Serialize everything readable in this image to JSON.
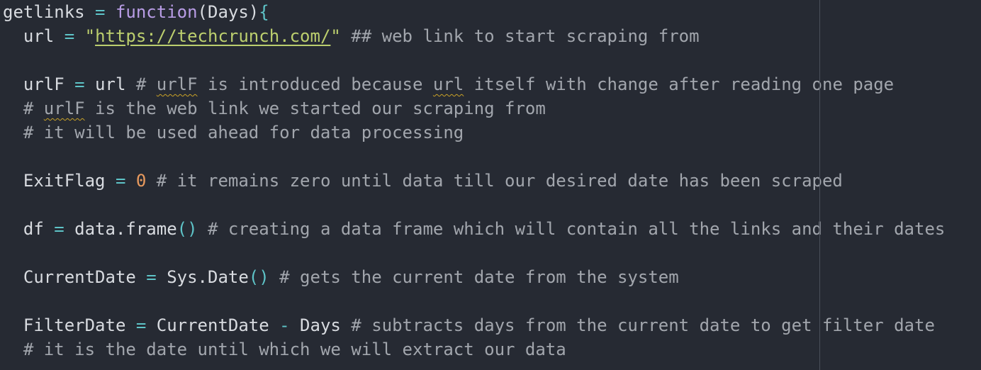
{
  "editor": {
    "lines": [
      [
        {
          "t": "getlinks",
          "c": "default"
        },
        {
          "t": " ",
          "c": "default"
        },
        {
          "t": "=",
          "c": "op"
        },
        {
          "t": " ",
          "c": "default"
        },
        {
          "t": "function",
          "c": "kw"
        },
        {
          "t": "(",
          "c": "default"
        },
        {
          "t": "Days",
          "c": "default"
        },
        {
          "t": ")",
          "c": "default"
        },
        {
          "t": "{",
          "c": "paren"
        }
      ],
      [
        {
          "t": "  url ",
          "c": "default"
        },
        {
          "t": "=",
          "c": "op"
        },
        {
          "t": " ",
          "c": "default"
        },
        {
          "t": "\"",
          "c": "str"
        },
        {
          "t": "https://techcrunch.com/",
          "c": "url"
        },
        {
          "t": "\"",
          "c": "str"
        },
        {
          "t": " ## web link to start scraping from",
          "c": "comment"
        }
      ],
      [],
      [
        {
          "t": "  urlF ",
          "c": "default"
        },
        {
          "t": "=",
          "c": "op"
        },
        {
          "t": " url ",
          "c": "default"
        },
        {
          "t": "# ",
          "c": "comment"
        },
        {
          "t": "urlF",
          "c": "comment",
          "spell": true
        },
        {
          "t": " is introduced because ",
          "c": "comment"
        },
        {
          "t": "url",
          "c": "comment",
          "spell": true
        },
        {
          "t": " itself with change after reading one page",
          "c": "comment"
        }
      ],
      [
        {
          "t": "  # ",
          "c": "comment"
        },
        {
          "t": "urlF",
          "c": "comment",
          "spell": true
        },
        {
          "t": " is the web link we started our scraping from",
          "c": "comment"
        }
      ],
      [
        {
          "t": "  # it will be used ahead for data processing",
          "c": "comment"
        }
      ],
      [],
      [
        {
          "t": "  ExitFlag ",
          "c": "default"
        },
        {
          "t": "=",
          "c": "op"
        },
        {
          "t": " ",
          "c": "default"
        },
        {
          "t": "0",
          "c": "num"
        },
        {
          "t": " # it remains zero until data till our desired date has been scraped",
          "c": "comment"
        }
      ],
      [],
      [
        {
          "t": "  df ",
          "c": "default"
        },
        {
          "t": "=",
          "c": "op"
        },
        {
          "t": " data.frame",
          "c": "default"
        },
        {
          "t": "()",
          "c": "paren"
        },
        {
          "t": " # creating a data frame which will contain all the links and their dates",
          "c": "comment"
        }
      ],
      [],
      [
        {
          "t": "  CurrentDate ",
          "c": "default"
        },
        {
          "t": "=",
          "c": "op"
        },
        {
          "t": " Sys.Date",
          "c": "default"
        },
        {
          "t": "()",
          "c": "paren"
        },
        {
          "t": " # gets the current date from the system",
          "c": "comment"
        }
      ],
      [],
      [
        {
          "t": "  FilterDate ",
          "c": "default"
        },
        {
          "t": "=",
          "c": "op"
        },
        {
          "t": " CurrentDate ",
          "c": "default"
        },
        {
          "t": "-",
          "c": "op"
        },
        {
          "t": " Days ",
          "c": "default"
        },
        {
          "t": "# subtracts days from the current date to get filter date",
          "c": "comment"
        }
      ],
      [
        {
          "t": "  # it is the date until which we will extract our data",
          "c": "comment"
        }
      ]
    ]
  },
  "colors": {
    "background": "#262a33",
    "default": "#d8dbe0",
    "operator": "#5ec4c8",
    "keyword": "#b99de6",
    "string": "#bccf6e",
    "number": "#e89a5e",
    "comment": "#a2a6ad",
    "spellcheck": "#c9a227"
  }
}
